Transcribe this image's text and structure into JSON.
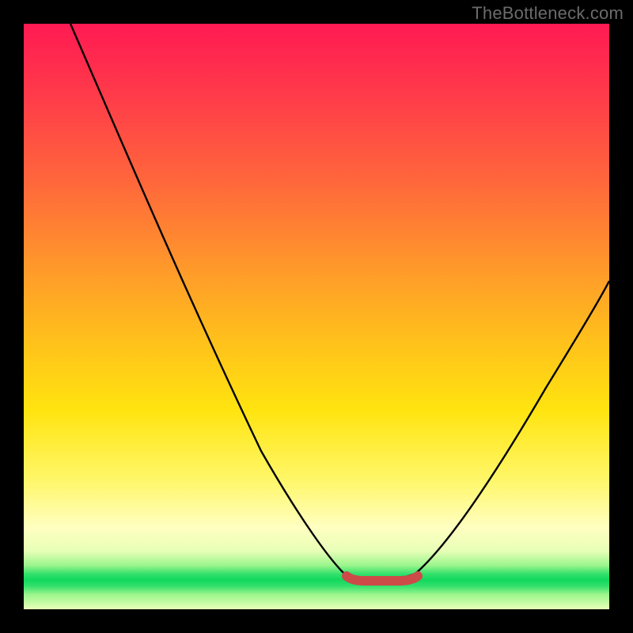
{
  "watermark": {
    "text": "TheBottleneck.com"
  },
  "chart_data": {
    "type": "line",
    "title": "",
    "xlabel": "",
    "ylabel": "",
    "xlim": [
      0,
      100
    ],
    "ylim": [
      0,
      100
    ],
    "gradient_stops": [
      {
        "pos": 0,
        "color": "#ff1a52"
      },
      {
        "pos": 28,
        "color": "#ff6a3a"
      },
      {
        "pos": 55,
        "color": "#ffc31a"
      },
      {
        "pos": 78,
        "color": "#fff76a"
      },
      {
        "pos": 94,
        "color": "#12d85e"
      },
      {
        "pos": 100,
        "color": "#e8ffb8"
      }
    ],
    "series": [
      {
        "name": "black-curve",
        "color": "#000000",
        "x": [
          8,
          15,
          22,
          30,
          38,
          46,
          52,
          56,
          58,
          60,
          63,
          66,
          70,
          73,
          76,
          80,
          85,
          90,
          96,
          100
        ],
        "y": [
          100,
          88,
          76,
          63,
          49,
          33,
          20,
          10,
          5,
          2,
          2,
          2,
          5,
          10,
          18,
          27,
          37,
          46,
          55,
          60
        ]
      },
      {
        "name": "red-flat-segment",
        "color": "#d9534f",
        "x": [
          56,
          70
        ],
        "y": [
          2,
          2
        ]
      }
    ]
  }
}
